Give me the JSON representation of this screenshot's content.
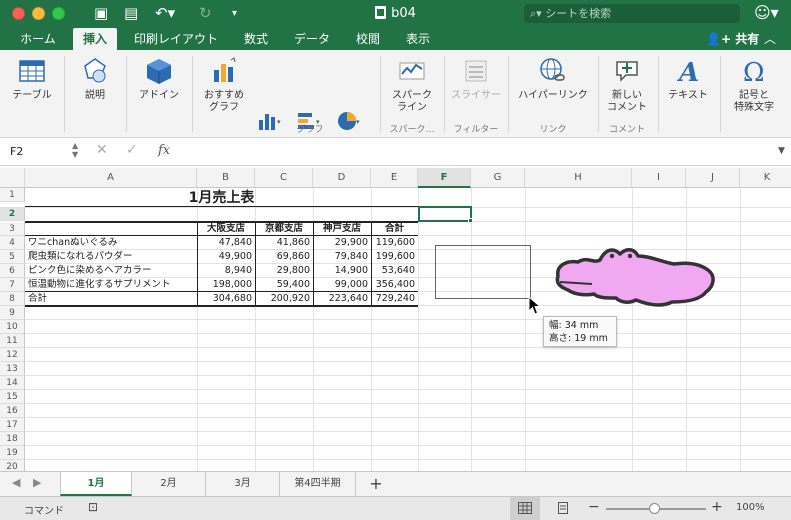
{
  "window": {
    "title": "b04",
    "search_placeholder": "シートを検索"
  },
  "tabs": [
    {
      "label": "ホーム",
      "active": false
    },
    {
      "label": "挿入",
      "active": true
    },
    {
      "label": "印刷レイアウト",
      "active": false
    },
    {
      "label": "数式",
      "active": false
    },
    {
      "label": "データ",
      "active": false
    },
    {
      "label": "校閲",
      "active": false
    },
    {
      "label": "表示",
      "active": false
    }
  ],
  "share_label": "共有",
  "ribbon": {
    "table": "テーブル",
    "illustration": "説明",
    "addin": "アドイン",
    "recommended_chart_1": "おすすめ",
    "recommended_chart_2": "グラフ",
    "sparkline_1": "スパーク",
    "sparkline_2": "ライン",
    "slicer": "スライサー",
    "hyperlink": "ハイパーリンク",
    "comment_1": "新しい",
    "comment_2": "コメント",
    "text": "テキスト",
    "symbol_1": "記号と",
    "symbol_2": "特殊文字",
    "groups": {
      "chart": "グラフ",
      "sparkline": "スパーク…",
      "filter": "フィルター",
      "link": "リンク",
      "comment": "コメント"
    }
  },
  "formula_bar": {
    "name_box": "F2",
    "fx": "fx"
  },
  "columns": [
    "A",
    "B",
    "C",
    "D",
    "E",
    "F",
    "G",
    "H",
    "I",
    "J",
    "K"
  ],
  "rows": [
    "1",
    "2",
    "3",
    "4",
    "5",
    "6",
    "7",
    "8",
    "9",
    "10",
    "11",
    "12",
    "13",
    "14",
    "15",
    "16",
    "17",
    "18",
    "19",
    "20"
  ],
  "sheet": {
    "title": "1月売上表",
    "headers": [
      "",
      "大阪支店",
      "京都支店",
      "神戸支店",
      "合計"
    ],
    "data": [
      [
        "ワニchanぬいぐるみ",
        "47,840",
        "41,860",
        "29,900",
        "119,600"
      ],
      [
        "爬虫類になれるパウダー",
        "49,900",
        "69,860",
        "79,840",
        "199,600"
      ],
      [
        "ピンク色に染めるヘアカラー",
        "8,940",
        "29,800",
        "14,900",
        "53,640"
      ],
      [
        "恒温動物に進化するサプリメント",
        "198,000",
        "59,400",
        "99,000",
        "356,400"
      ],
      [
        "合計",
        "304,680",
        "200,920",
        "223,640",
        "729,240"
      ]
    ]
  },
  "tooltip": {
    "width": "幅:  34 mm",
    "height": "高さ:  19 mm"
  },
  "sheet_tabs": [
    {
      "label": "1月",
      "active": true
    },
    {
      "label": "2月",
      "active": false
    },
    {
      "label": "3月",
      "active": false
    },
    {
      "label": "第4四半期",
      "active": false
    }
  ],
  "status": {
    "mode": "コマンド",
    "zoom": "100%"
  },
  "colors": {
    "accent": "#217346",
    "shape_fill": "#f0a8f0",
    "shape_stroke": "#333333"
  }
}
